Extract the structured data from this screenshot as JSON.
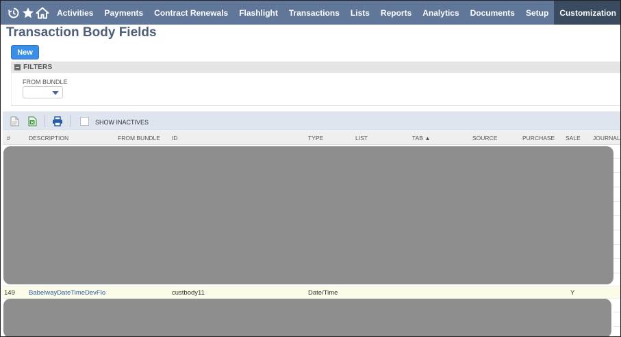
{
  "nav": {
    "menu": [
      "Activities",
      "Payments",
      "Contract Renewals",
      "Flashlight",
      "Transactions",
      "Lists",
      "Reports",
      "Analytics",
      "Documents",
      "Setup",
      "Customization"
    ],
    "active": "Customization",
    "icons": [
      "recent-icon",
      "star-icon",
      "home-icon"
    ]
  },
  "page": {
    "title": "Transaction Body Fields",
    "new_label": "New"
  },
  "filters": {
    "header": "FILTERS",
    "from_bundle_label": "FROM BUNDLE",
    "from_bundle_value": ""
  },
  "toolbar": {
    "show_inactives_label": "SHOW INACTIVES",
    "icons": [
      "export-csv-icon",
      "export-excel-icon",
      "print-icon"
    ]
  },
  "table": {
    "columns": [
      "#",
      "DESCRIPTION",
      "FROM BUNDLE",
      "ID",
      "TYPE",
      "LIST",
      "TAB ▲",
      "SOURCE",
      "PURCHASE",
      "SALE",
      "JOURNAL"
    ],
    "rows": [
      {
        "num": "149",
        "description": "BabelwayDateTimeDevFlo",
        "from_bundle": "",
        "id": "custbody11",
        "type": "Date/Time",
        "list": "",
        "tab": "",
        "source": "",
        "purchase": "",
        "sale": "Y",
        "journal": ""
      }
    ]
  },
  "colors": {
    "nav_bg": "#607799",
    "nav_active": "#3a4a5f",
    "title": "#4d5f79",
    "primary_button": "#3a8ee6",
    "link": "#2d5ca6",
    "highlight_row": "#fcfbe8"
  }
}
